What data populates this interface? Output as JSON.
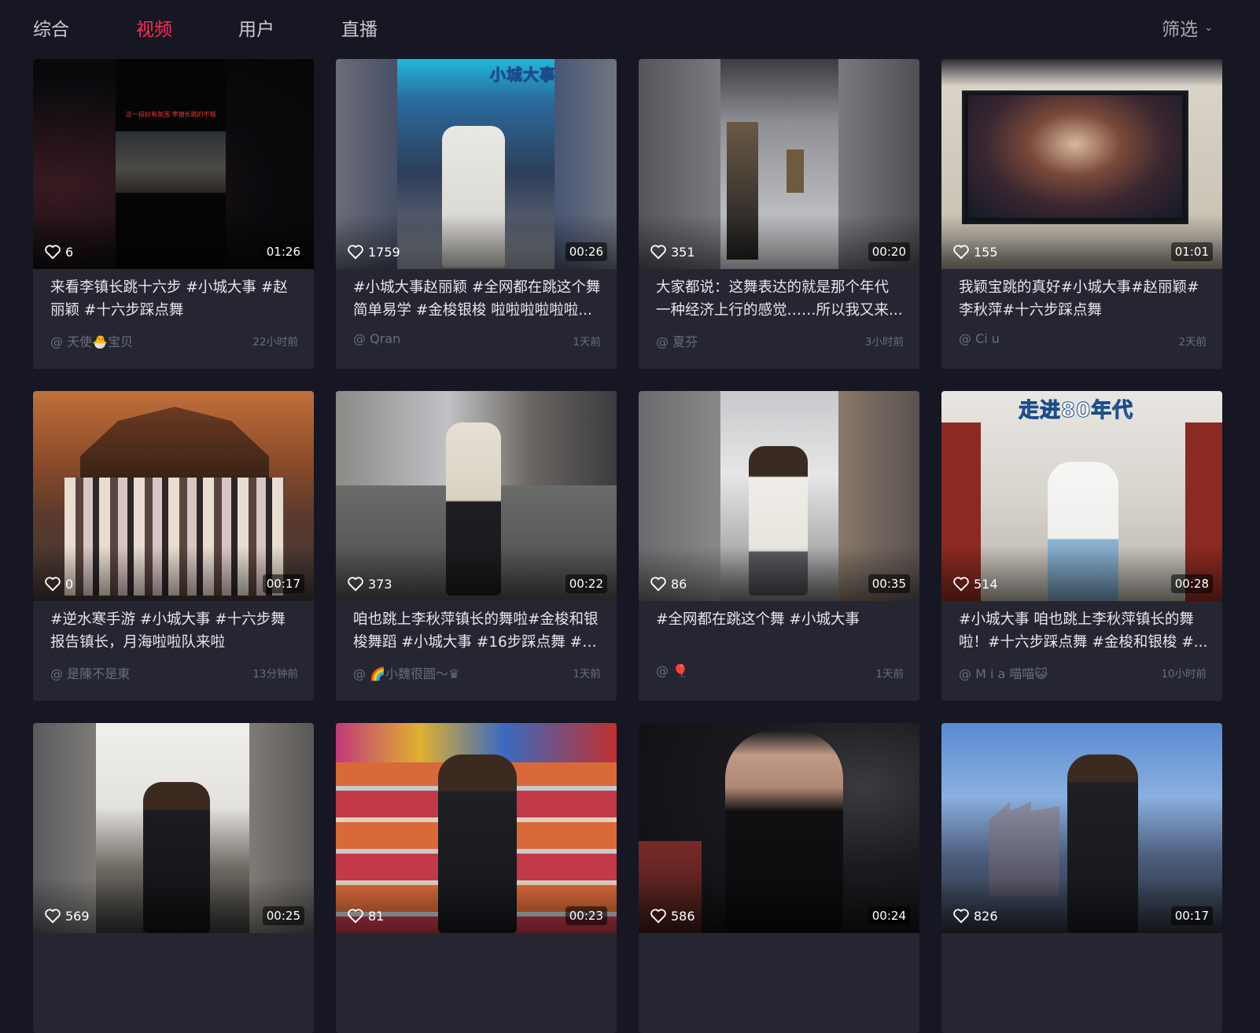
{
  "tabs": {
    "items": [
      "综合",
      "视频",
      "用户",
      "直播"
    ],
    "active_index": 1
  },
  "filter": {
    "label": "筛选"
  },
  "colors": {
    "background": "#161722",
    "card": "#252632",
    "accent": "#fe2c55",
    "muted": "#6b6d7a"
  },
  "cards": [
    {
      "likes": "6",
      "duration": "01:26",
      "title": "来看李镇长跳十六步 #小城大事 #赵丽颖 #十六步踩点舞",
      "author": "@ 天使🐣宝贝",
      "time": "22小时前",
      "overlay": "这一段好有氛围 李镇长跳的不错"
    },
    {
      "likes": "1759",
      "duration": "00:26",
      "title": "#小城大事赵丽颖 #全网都在跳这个舞 简单易学 #金梭银梭 啦啦啦啦啦啦...",
      "author": "@ Qran",
      "time": "1天前",
      "overlay": "小城大事"
    },
    {
      "likes": "351",
      "duration": "00:20",
      "title": "大家都说：这舞表达的就是那个年代 一种经济上行的感觉……所以我又来...",
      "author": "@ 夏芬",
      "time": "3小时前"
    },
    {
      "likes": "155",
      "duration": "01:01",
      "title": "我颖宝跳的真好#小城大事#赵丽颖# 李秋萍#十六步踩点舞",
      "author": "@ Ci u",
      "time": "2天前"
    },
    {
      "likes": "0",
      "duration": "00:17",
      "title": "#逆水寒手游 #小城大事 #十六步舞 报告镇长，月海啦啦队来啦",
      "author": "@ 是陳不是東",
      "time": "13分钟前"
    },
    {
      "likes": "373",
      "duration": "00:22",
      "title": "咱也跳上李秋萍镇长的舞啦#金梭和银 梭舞蹈 #小城大事 #16步踩点舞 #学...",
      "author": "@ 🌈小魏很圆～♛",
      "time": "1天前"
    },
    {
      "likes": "86",
      "duration": "00:35",
      "title": "#全网都在跳这个舞 #小城大事",
      "author": "@ 🎈",
      "time": "1天前"
    },
    {
      "likes": "514",
      "duration": "00:28",
      "title": "#小城大事 咱也跳上李秋萍镇长的舞 啦！#十六步踩点舞 #金梭和银梭 #...",
      "author": "@ M i a 喵喵😺",
      "time": "10小时前",
      "overlay": "走进80年代"
    },
    {
      "likes": "569",
      "duration": "00:25",
      "title": "",
      "author": "",
      "time": ""
    },
    {
      "likes": "81",
      "duration": "00:23",
      "title": "",
      "author": "",
      "time": ""
    },
    {
      "likes": "586",
      "duration": "00:24",
      "title": "",
      "author": "",
      "time": ""
    },
    {
      "likes": "826",
      "duration": "00:17",
      "title": "",
      "author": "",
      "time": ""
    }
  ]
}
